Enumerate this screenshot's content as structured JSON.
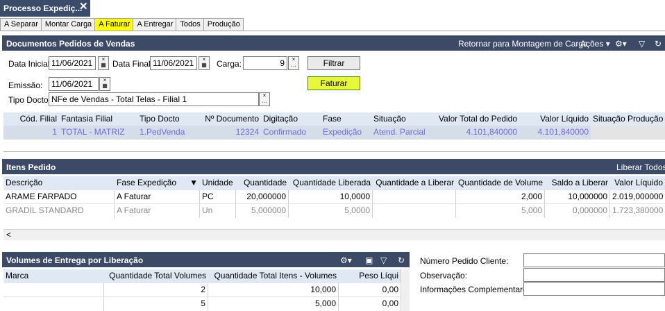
{
  "window": {
    "title": "Processo Expediç...",
    "close": "✕"
  },
  "tabs": [
    {
      "label": "A Separar",
      "active": false
    },
    {
      "label": "Montar Carga",
      "active": false
    },
    {
      "label": "A Faturar",
      "active": true
    },
    {
      "label": "A Entregar",
      "active": false
    },
    {
      "label": "Todos",
      "active": false
    },
    {
      "label": "Produção",
      "active": false
    }
  ],
  "docs": {
    "title": "Documentos Pedidos de Vendas",
    "retornar": "Retornar para Montagem de Carga",
    "acoes": "Ações",
    "data_inicial_label": "Data Inicial:",
    "data_inicial": "11/06/2021",
    "data_final_label": "Data Final:",
    "data_final": "11/06/2021",
    "carga_label": "Carga:",
    "carga": "9",
    "filtrar": "Filtrar",
    "emissao_label": "Emissão:",
    "emissao": "11/06/2021",
    "faturar": "Faturar",
    "tipo_docto_label": "Tipo Docto:",
    "tipo_docto": "NFe de Vendas - Total Telas -  Filial 1",
    "columns": [
      "Cód. Filial",
      "Fantasia Filial",
      "Tipo Docto",
      "Nº Documento",
      "Digitação",
      "Fase",
      "Situação",
      "Valor Total do Pedido",
      "Valor Líquido",
      "Situação Produção"
    ],
    "rows": [
      [
        "1",
        "TOTAL - MATRIZ",
        "1.PedVenda",
        "12324",
        "Confirmado",
        "Expedição",
        "Atend. Parcial",
        "4.101,840000",
        "4.101,840000",
        ""
      ]
    ]
  },
  "itens": {
    "title": "Itens Pedido",
    "liberar_todos": "Liberar Todos",
    "columns": [
      "Descrição",
      "Fase Expedição",
      "Unidade",
      "Quantidade",
      "Quantidade Liberada",
      "Quantidade a Liberar",
      "Quantidade de Volume",
      "Saldo a Liberar",
      "Valor Líquido"
    ],
    "rows": [
      [
        "ARAME FARPADO",
        "A Faturar",
        "PC",
        "20,000000",
        "10,0000",
        "",
        "2,000",
        "10,000000",
        "2.019,000000"
      ],
      [
        "GRADIL STANDARD",
        "A Faturar",
        "Un",
        "5,000000",
        "5,0000",
        "",
        "5,000",
        "0,000000",
        "1.723,380000"
      ]
    ],
    "scroll_left": "<"
  },
  "volumes": {
    "title": "Volumes de Entrega por Liberação",
    "columns": [
      "Marca",
      "Quantidade Total Volumes",
      "Quantidade Total Itens - Volumes",
      "Peso Líqui"
    ],
    "rows": [
      [
        "",
        "2",
        "10,000",
        "0,00"
      ],
      [
        "",
        "5",
        "5,000",
        "0,00"
      ]
    ]
  },
  "side": {
    "numero_pedido_label": "Número Pedido Cliente:",
    "observacao_label": "Observação:",
    "info_label": "Informações Complementares:"
  }
}
